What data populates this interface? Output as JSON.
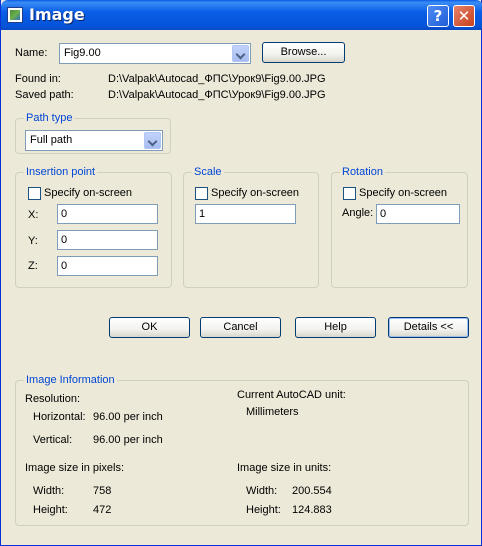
{
  "window": {
    "title": "Image"
  },
  "title_buttons": {
    "help": "?",
    "close": "✕"
  },
  "name": {
    "label": "Name:",
    "value": "Fig9.00",
    "browse_label": "Browse..."
  },
  "found_in": {
    "label": "Found in:",
    "value": "D:\\Valpak\\Autocad_ФПС\\Урок9\\Fig9.00.JPG"
  },
  "saved_path": {
    "label": "Saved path:",
    "value": "D:\\Valpak\\Autocad_ФПС\\Урок9\\Fig9.00.JPG"
  },
  "path_type": {
    "title": "Path type",
    "value": "Full path"
  },
  "insertion_point": {
    "title": "Insertion point",
    "specify_label": "Specify on-screen",
    "x_label": "X:",
    "x_value": "0",
    "y_label": "Y:",
    "y_value": "0",
    "z_label": "Z:",
    "z_value": "0"
  },
  "scale": {
    "title": "Scale",
    "specify_label": "Specify on-screen",
    "value": "1"
  },
  "rotation": {
    "title": "Rotation",
    "specify_label": "Specify on-screen",
    "angle_label": "Angle:",
    "angle_value": "0"
  },
  "buttons": {
    "ok": "OK",
    "cancel": "Cancel",
    "help": "Help",
    "details": "Details <<"
  },
  "image_info": {
    "title": "Image Information",
    "resolution_label": "Resolution:",
    "horizontal_label": "Horizontal:",
    "horizontal_value": "96.00 per inch",
    "vertical_label": "Vertical:",
    "vertical_value": "96.00 per inch",
    "current_unit_label": "Current AutoCAD unit:",
    "current_unit_value": "Millimeters",
    "pixels_label": "Image size in pixels:",
    "px_width_label": "Width:",
    "px_width_value": "758",
    "px_height_label": "Height:",
    "px_height_value": "472",
    "units_label": "Image size in units:",
    "u_width_label": "Width:",
    "u_width_value": "200.554",
    "u_height_label": "Height:",
    "u_height_value": "124.883"
  },
  "icons": {
    "app": "autocad-image-icon",
    "dropdown": "chevron-down-icon"
  }
}
